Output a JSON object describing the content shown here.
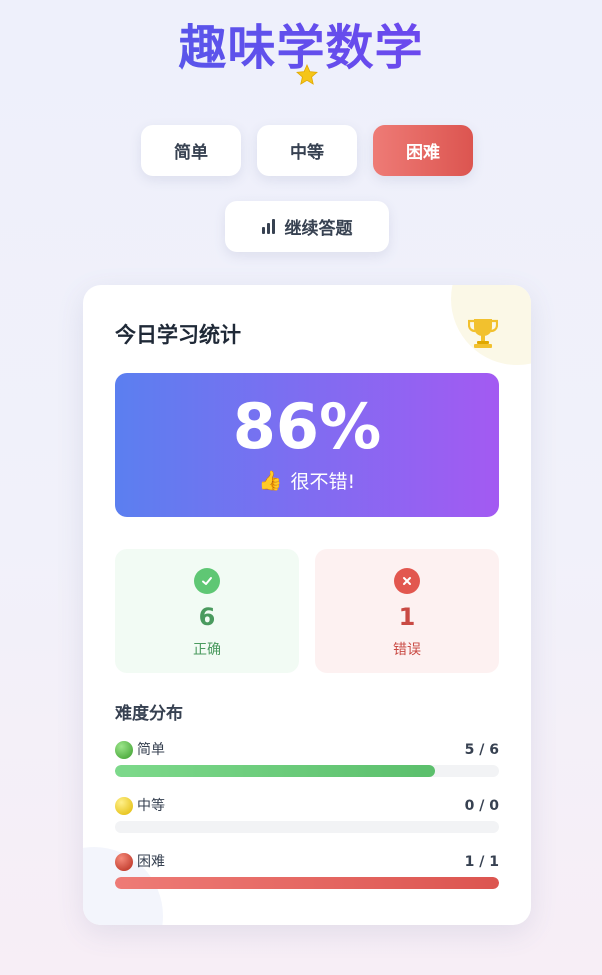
{
  "header": {
    "title": "趣味学数学"
  },
  "difficulty_buttons": [
    {
      "label": "简单",
      "active": false
    },
    {
      "label": "中等",
      "active": false
    },
    {
      "label": "困难",
      "active": true
    }
  ],
  "continue_button": {
    "label": "继续答题",
    "icon": "bar-chart-icon"
  },
  "stats_card": {
    "title": "今日学习统计",
    "score": {
      "value": "86%",
      "emoji": "👍",
      "label": "很不错!"
    },
    "correct": {
      "value": "6",
      "label": "正确"
    },
    "wrong": {
      "value": "1",
      "label": "错误"
    },
    "distribution": {
      "title": "难度分布",
      "items": [
        {
          "name": "简单",
          "count": "5 / 6",
          "fraction": 0.8333,
          "color": "#5fc774"
        },
        {
          "name": "中等",
          "count": "0 / 0",
          "fraction": 0,
          "color": "#f5c518"
        },
        {
          "name": "困难",
          "count": "1 / 1",
          "fraction": 1,
          "color": "#e2574f"
        }
      ]
    }
  },
  "colors": {
    "title_gradient": [
      "#4b5ee8",
      "#7a3ff0"
    ],
    "active_button": "#dc5550",
    "score_gradient": [
      "#5b7ff0",
      "#a35af2"
    ]
  }
}
